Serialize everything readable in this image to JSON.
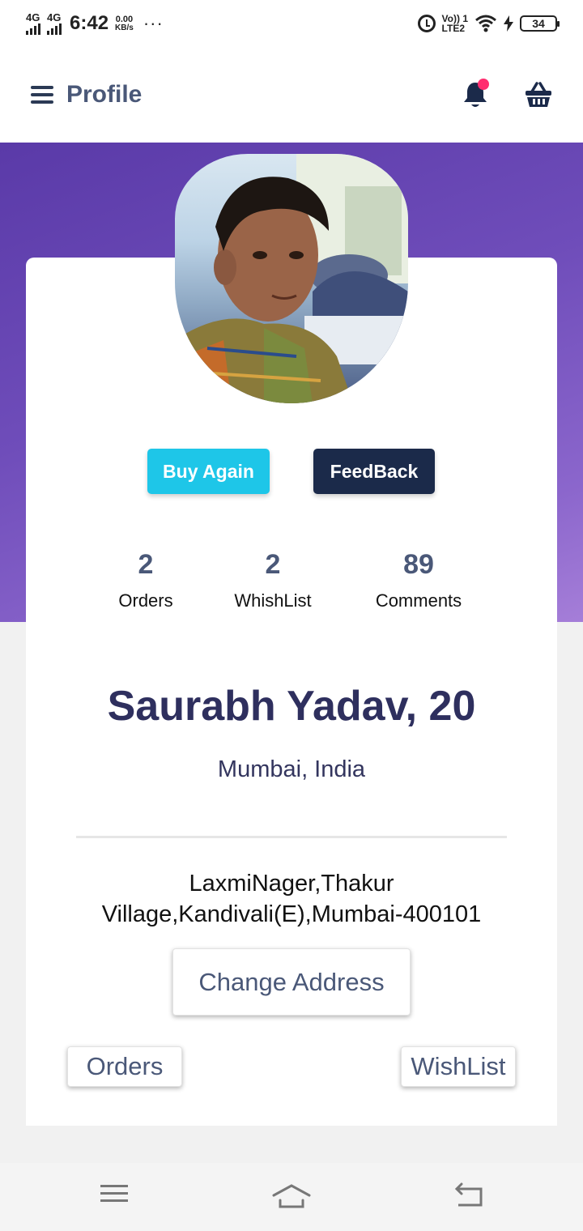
{
  "status_bar": {
    "network_1": "4G",
    "network_2": "4G",
    "time": "6:42",
    "speed_value": "0.00",
    "speed_unit": "KB/s",
    "more": "···",
    "volte_top": "Vo)) 1",
    "volte_bottom": "LTE2",
    "battery": "34",
    "battery_level": 0.34
  },
  "header": {
    "title": "Profile"
  },
  "actions": {
    "buy_again": "Buy Again",
    "feedback": "FeedBack"
  },
  "stats": [
    {
      "value": "2",
      "label": "Orders"
    },
    {
      "value": "2",
      "label": "WhishList"
    },
    {
      "value": "89",
      "label": "Comments"
    }
  ],
  "profile": {
    "name": "Saurabh Yadav, 20",
    "location": "Mumbai, India",
    "address_line1": "LaxmiNager,Thakur",
    "address_line2": "Village,Kandivali(E),Mumbai-400101"
  },
  "buttons": {
    "change_address": "Change Address",
    "orders": "Orders",
    "wishlist": "WishList"
  },
  "colors": {
    "accent_cyan": "#1ec6e8",
    "navy": "#1b2a4a",
    "purple": "#6f4dba",
    "badge_pink": "#ff2d6f"
  },
  "icons": {
    "menu": "hamburger-icon",
    "notifications": "bell-icon",
    "cart": "basket-icon",
    "nav_menu": "menu-icon",
    "nav_home": "home-icon",
    "nav_back": "back-icon"
  }
}
